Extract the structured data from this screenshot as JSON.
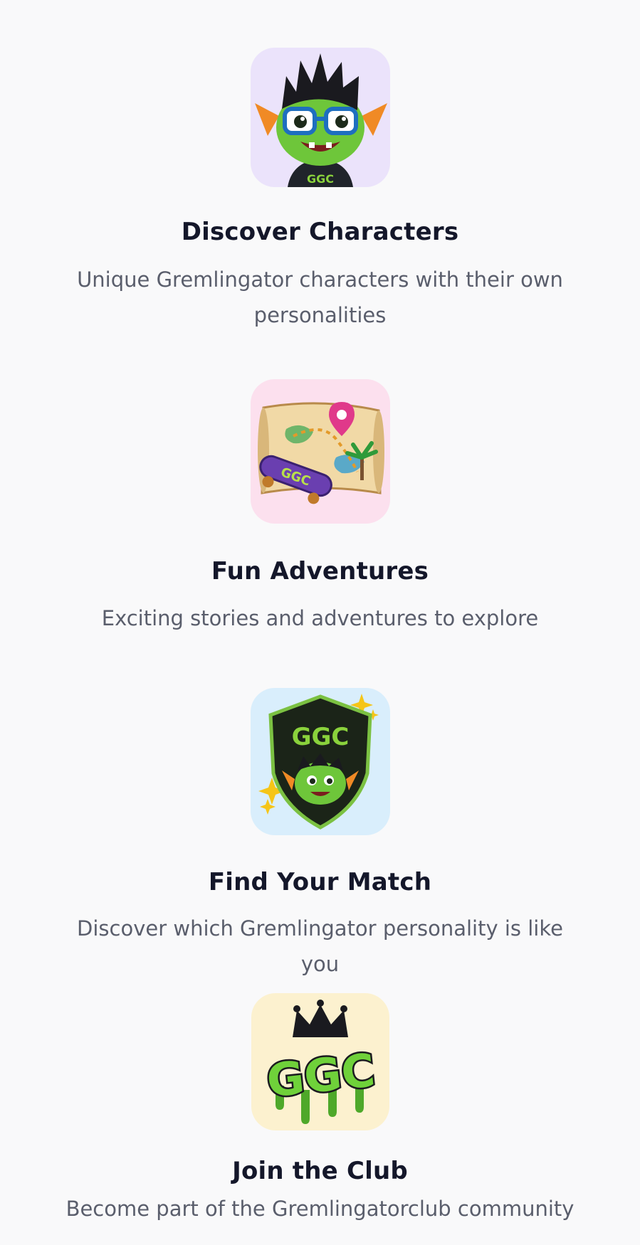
{
  "features": [
    {
      "title": "Discover Characters",
      "description": "Unique Gremlingator characters with their own personalities",
      "icon": "gremlin-character-icon",
      "tile_color": "#ebe3fb",
      "image_text": "GGC"
    },
    {
      "title": "Fun Adventures",
      "description": "Exciting stories and adventures to explore",
      "icon": "treasure-map-icon",
      "tile_color": "#fce0ee",
      "image_text": "GGC"
    },
    {
      "title": "Find Your Match",
      "description": "Discover which Gremlingator personality is like you",
      "icon": "shield-badge-icon",
      "tile_color": "#d9eefc",
      "image_text": "GGC"
    },
    {
      "title": "Join the Club",
      "description": "Become part of the Gremlingatorclub community",
      "icon": "crown-logo-icon",
      "tile_color": "#fcf1cf",
      "image_text": "GGC"
    }
  ]
}
